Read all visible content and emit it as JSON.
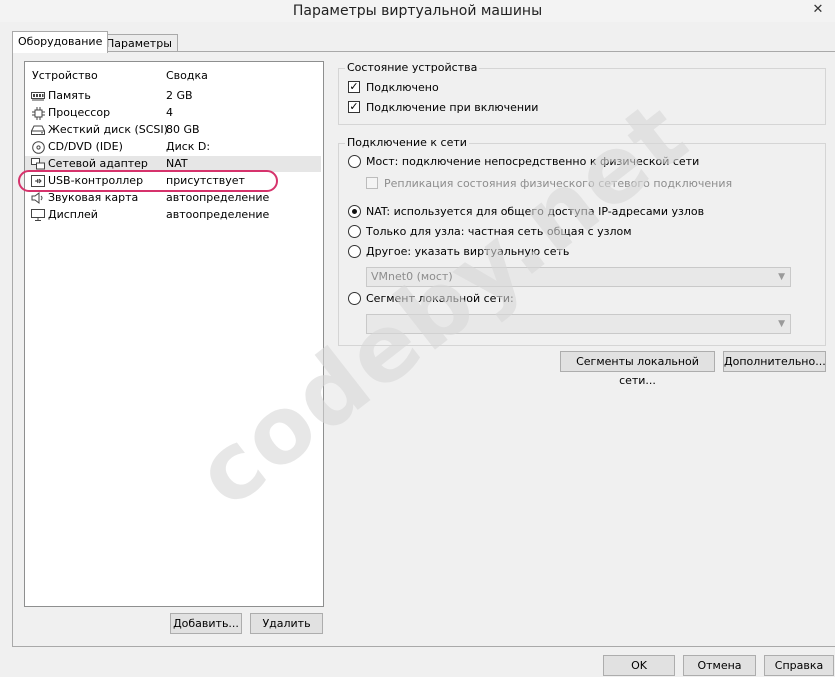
{
  "window": {
    "title": "Параметры виртуальной машины",
    "close_glyph": "✕"
  },
  "tabs": [
    {
      "label": "Оборудование",
      "active": true
    },
    {
      "label": "Параметры",
      "active": false
    }
  ],
  "device_list": {
    "columns": {
      "device": "Устройство",
      "summary": "Сводка"
    },
    "rows": [
      {
        "icon": "memory-icon",
        "name": "Память",
        "summary": "2 GB"
      },
      {
        "icon": "processor-icon",
        "name": "Процессор",
        "summary": "4"
      },
      {
        "icon": "hard-disk-icon",
        "name": "Жесткий диск (SCSI)",
        "summary": "80 GB"
      },
      {
        "icon": "cd-dvd-icon",
        "name": "CD/DVD (IDE)",
        "summary": "Диск D:"
      },
      {
        "icon": "network-adapter-icon",
        "name": "Сетевой адаптер",
        "summary": "NAT",
        "selected": true
      },
      {
        "icon": "usb-icon",
        "name": "USB-контроллер",
        "summary": "присутствует"
      },
      {
        "icon": "sound-card-icon",
        "name": "Звуковая карта",
        "summary": "автоопределение"
      },
      {
        "icon": "display-icon",
        "name": "Дисплей",
        "summary": "автоопределение"
      }
    ]
  },
  "list_buttons": {
    "add": "Добавить...",
    "remove": "Удалить"
  },
  "device_status": {
    "title": "Состояние устройства",
    "connected": {
      "label": "Подключено",
      "checked": true
    },
    "connect_on_power": {
      "label": "Подключение при включении",
      "checked": true
    }
  },
  "network": {
    "title": "Подключение к сети",
    "bridged": {
      "label": "Мост: подключение непосредственно к физической сети",
      "selected": false
    },
    "replicate": {
      "label": "Репликация состояния физического сетевого подключения",
      "checked": false,
      "enabled": false
    },
    "nat": {
      "label": "NAT: используется для общего доступа IP-адресами узлов",
      "selected": true
    },
    "host_only": {
      "label": "Только для узла: частная сеть общая с узлом",
      "selected": false
    },
    "custom": {
      "label": "Другое: указать виртуальную сеть",
      "selected": false
    },
    "custom_select_value": "VMnet0 (мост)",
    "lan_segment": {
      "label": "Сегмент локальной сети:",
      "selected": false
    },
    "lan_segment_select_value": ""
  },
  "network_buttons": {
    "lan_segments": "Сегменты локальной сети...",
    "advanced": "Дополнительно..."
  },
  "footer_buttons": {
    "ok": "OK",
    "cancel": "Отмена",
    "help": "Справка"
  },
  "watermark": "codeby.net",
  "colors": {
    "highlight_ring": "#d6336c",
    "selected_row": "#e6e6e6"
  }
}
